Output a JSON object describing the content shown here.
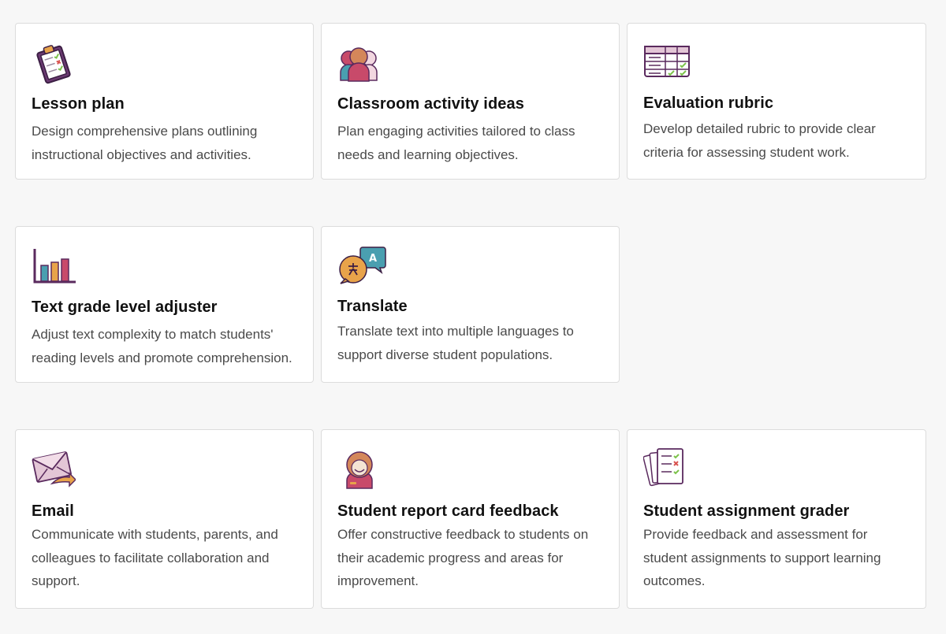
{
  "cards": [
    {
      "title": "Lesson plan",
      "description": "Design comprehensive plans outlining instructional objectives and activities.",
      "icon": "clipboard-icon"
    },
    {
      "title": "Classroom activity ideas",
      "description": "Plan engaging activities tailored to class needs and learning objectives.",
      "icon": "group-icon"
    },
    {
      "title": "Evaluation rubric",
      "description": "Develop detailed rubric to provide clear criteria for assessing student work.",
      "icon": "rubric-table-icon"
    },
    {
      "title": "Text grade level adjuster",
      "description": "Adjust text complexity to match students' reading levels and promote comprehension.",
      "icon": "bar-chart-icon"
    },
    {
      "title": "Translate",
      "description": "Translate text into multiple languages to support diverse student populations.",
      "icon": "translate-bubbles-icon"
    },
    {
      "title": "Email",
      "description": "Communicate with students, parents, and colleagues to facilitate collaboration and support.",
      "icon": "envelope-icon"
    },
    {
      "title": "Student report card feedback",
      "description": "Offer constructive feedback to students on their academic progress and areas for improvement.",
      "icon": "student-icon"
    },
    {
      "title": "Student assignment grader",
      "description": "Provide feedback and assessment for student assignments to support learning outcomes.",
      "icon": "graded-papers-icon"
    }
  ],
  "colors": {
    "accent": "#5a2a5e",
    "check_green": "#7cc24a",
    "cross_red": "#d9534f",
    "orange": "#e8a34a",
    "teal": "#4a9fb0",
    "pink": "#c84a6a"
  }
}
